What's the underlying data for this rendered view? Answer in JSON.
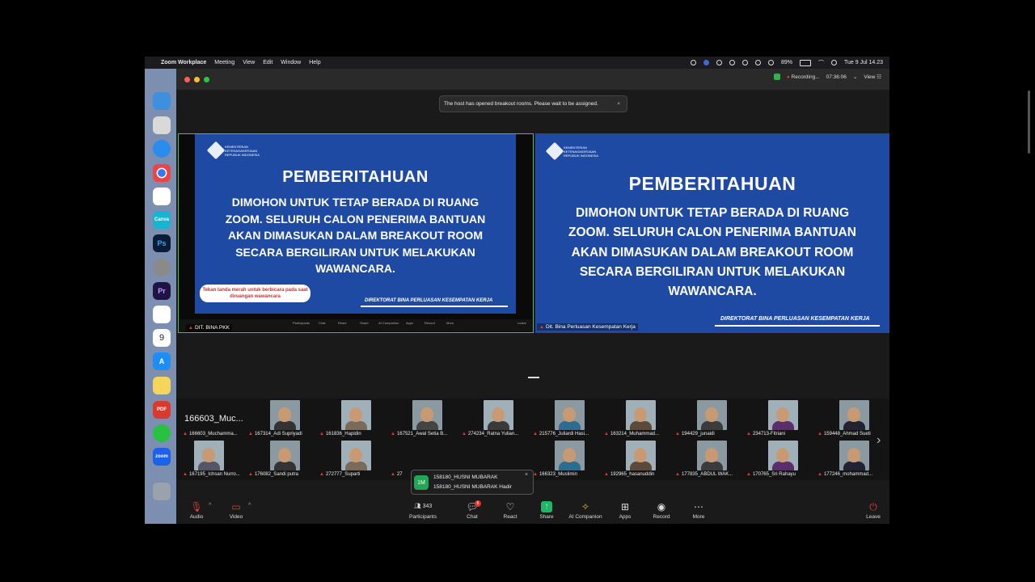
{
  "menubar": {
    "app": "Zoom Workplace",
    "items": [
      "Meeting",
      "View",
      "Edit",
      "Window",
      "Help"
    ],
    "battery": "89%",
    "datetime": "Tue 9 Jul  14.23"
  },
  "titlebar": {
    "recording": "Recording...",
    "timer": "07:36:06",
    "view": "View"
  },
  "toast": {
    "message": "The host has opened breakout rooms. Please wait to be assigned.",
    "close": "×"
  },
  "slide": {
    "logo_text": "KEMENTERIAN KETENAGAKERJAAN REPUBLIK INDONESIA",
    "title": "PEMBERITAHUAN",
    "lines": [
      "DIMOHON UNTUK TETAP BERADA DI RUANG",
      "ZOOM. SELURUH CALON PENERIMA BANTUAN",
      "AKAN DIMASUKAN DALAM BREAKOUT ROOM",
      "SECARA BERGILIRAN UNTUK MELAKUKAN",
      "WAWANCARA."
    ],
    "footer": "DIREKTORAT BINA PERLUASAN KESEMPATAN KERJA",
    "callout": "Tekan tanda merah untuk berbicara pada saat diruangan wawancara"
  },
  "speakers": {
    "left_name": "DIT. BINA PKK",
    "right_name": "Dit. Bina Perluasan Kesempatan Kerja"
  },
  "strip": {
    "first_name": "166603_Muc...",
    "row1": [
      "166603_Muchamma...",
      "167314_Adi Supriyadi",
      "161836_Hapidin",
      "167521_Awal Setia B...",
      "274234_Ratna Yulian...",
      "215776_Juliardi Hasi...",
      "163214_Muhammad...",
      "194429_junaidi",
      "234713-Fitriani",
      "159448_Ahmad Sueti"
    ],
    "row2": [
      "167195_Ichsan Nurro...",
      "176082_Sandi putra",
      "272777_Suparti",
      "27",
      "",
      "166323_Muslimin",
      "192965_hasanuddin",
      "177835_ABDUL WAK...",
      "170765_Sri Rahayu",
      "177246_mohammad..."
    ]
  },
  "chat_popup": {
    "avatar": "1M",
    "sender": "158180_HUSNI MUBARAK",
    "message": "158180_HUSNI MUBARAK Hadir",
    "close": "×"
  },
  "toolbar": {
    "audio": "Audio",
    "video": "Video",
    "participants": "Participants",
    "participant_count": "343",
    "chat": "Chat",
    "chat_badge": "6",
    "react": "React",
    "share": "Share",
    "ai": "AI Companion",
    "apps": "Apps",
    "record": "Record",
    "more": "More",
    "leave": "Leave"
  },
  "mini_toolbar": [
    "Participants",
    "Chat",
    "React",
    "Share",
    "AI Companion",
    "Apps",
    "Record",
    "More",
    "Leave"
  ],
  "colors": {
    "slide_blue": "#1e4aa3",
    "active_border": "#3ec36a",
    "share_green": "#1fb66a",
    "badge_red": "#e0322f",
    "avatar_green": "#21a557"
  }
}
